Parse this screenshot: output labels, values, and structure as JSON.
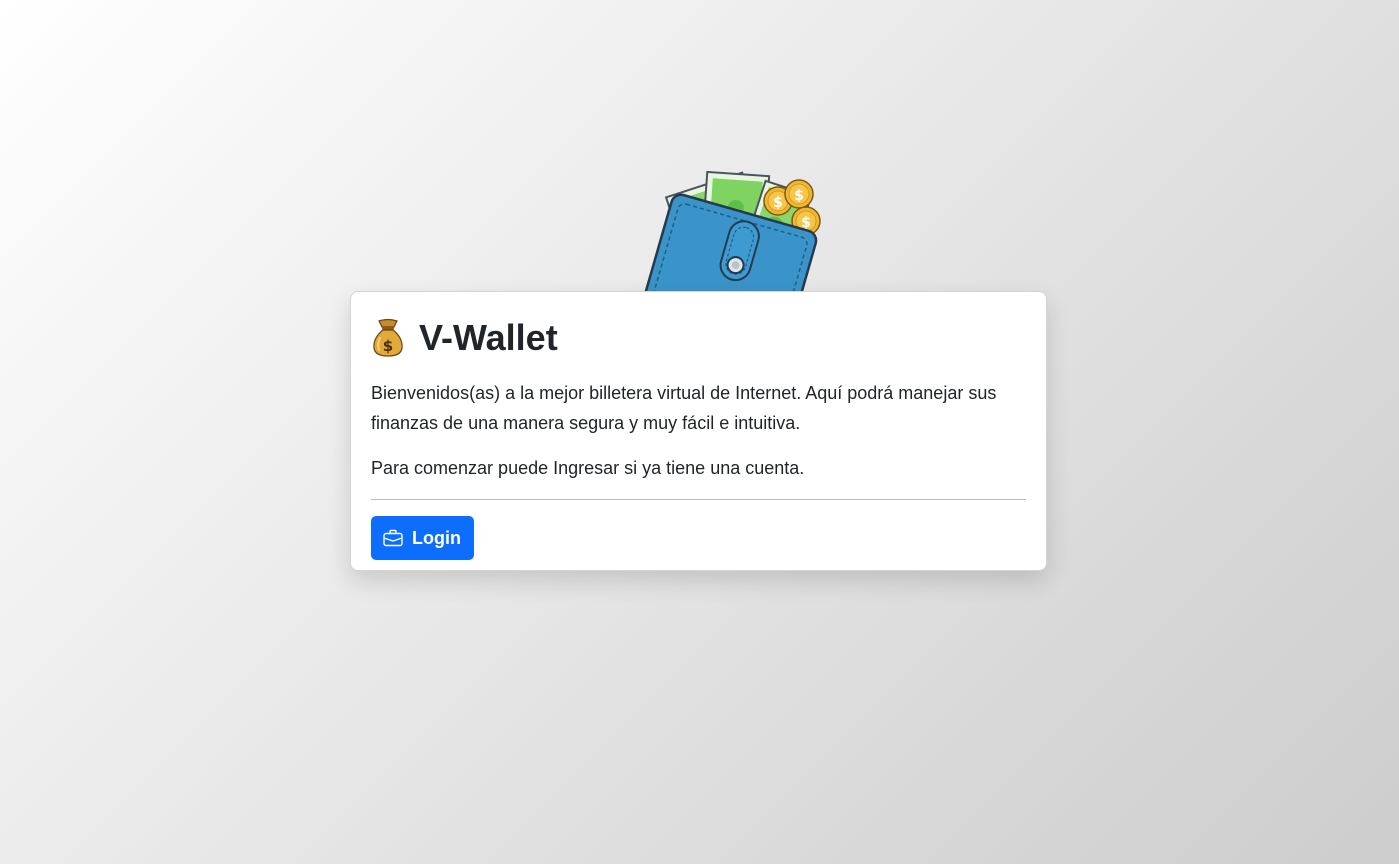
{
  "hero": {
    "image_name": "wallet-with-cash-and-coins"
  },
  "card": {
    "icon": "money-bag-icon",
    "title": "V-Wallet",
    "intro": "Bienvenidos(as) a la mejor billetera virtual de Internet. Aquí podrá manejar sus finanzas de una manera segura y muy fácil e intuitiva.",
    "start_text": "Para comenzar puede Ingresar si ya tiene una cuenta.",
    "login_button": {
      "label": "Login",
      "icon": "briefcase-icon"
    }
  },
  "colors": {
    "primary": "#0d6efd",
    "wallet": "#3a93c9",
    "cash": "#6fce54",
    "coin": "#f2b632"
  }
}
